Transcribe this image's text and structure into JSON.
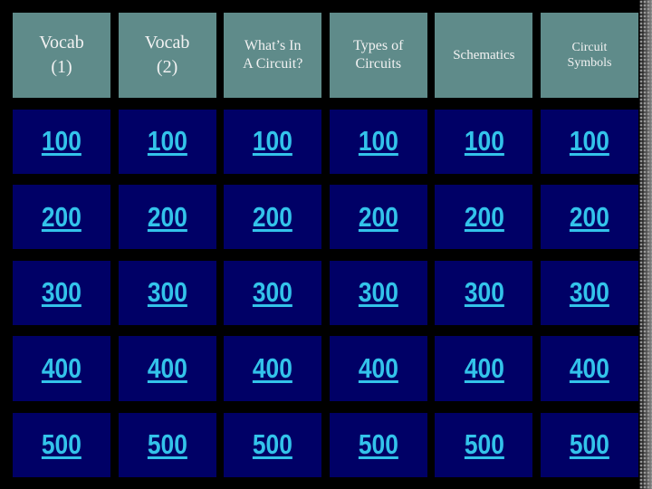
{
  "categories": [
    "Vocab\n(1)",
    "Vocab\n(2)",
    "What’s In\nA Circuit?",
    "Types of\nCircuits",
    "Schematics",
    "Circuit\nSymbols"
  ],
  "point_values": [
    "100",
    "200",
    "300",
    "400",
    "500"
  ],
  "colors": {
    "header_bg": "#5f8b8a",
    "cell_bg": "#000066",
    "value_text": "#33c3ea",
    "background": "#000000"
  }
}
